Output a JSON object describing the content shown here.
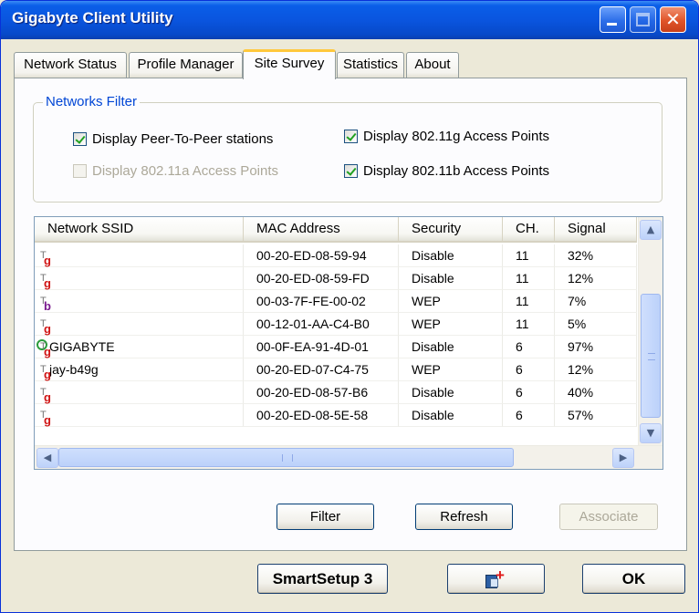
{
  "window": {
    "title": "Gigabyte Client Utility"
  },
  "tabs": [
    {
      "label": "Network Status"
    },
    {
      "label": "Profile Manager"
    },
    {
      "label": "Site Survey"
    },
    {
      "label": "Statistics"
    },
    {
      "label": "About"
    }
  ],
  "active_tab": "Site Survey",
  "filter": {
    "legend": "Networks Filter",
    "options": [
      {
        "label": "Display Peer-To-Peer stations",
        "checked": true,
        "enabled": true
      },
      {
        "label": "Display 802.11a Access Points",
        "checked": false,
        "enabled": false
      },
      {
        "label": "Display 802.11g Access Points",
        "checked": true,
        "enabled": true
      },
      {
        "label": "Display 802.11b Access Points",
        "checked": true,
        "enabled": true
      }
    ]
  },
  "table": {
    "columns": [
      "Network SSID",
      "MAC Address",
      "Security",
      "CH.",
      "Signal"
    ],
    "rows": [
      {
        "band": "g",
        "ssid": "",
        "mac": "00-20-ED-08-59-94",
        "security": "Disable",
        "ch": "11",
        "signal": "32%"
      },
      {
        "band": "g",
        "ssid": "",
        "mac": "00-20-ED-08-59-FD",
        "security": "Disable",
        "ch": "11",
        "signal": "12%"
      },
      {
        "band": "b",
        "ssid": "",
        "mac": "00-03-7F-FE-00-02",
        "security": "WEP",
        "ch": "11",
        "signal": "7%"
      },
      {
        "band": "g",
        "ssid": "",
        "mac": "00-12-01-AA-C4-B0",
        "security": "WEP",
        "ch": "11",
        "signal": "5%"
      },
      {
        "band": "g",
        "ssid": "GIGABYTE",
        "mac": "00-0F-EA-91-4D-01",
        "security": "Disable",
        "ch": "6",
        "signal": "97%",
        "connected": true
      },
      {
        "band": "g",
        "ssid": "jay-b49g",
        "mac": "00-20-ED-07-C4-75",
        "security": "WEP",
        "ch": "6",
        "signal": "12%"
      },
      {
        "band": "g",
        "ssid": "",
        "mac": "00-20-ED-08-57-B6",
        "security": "Disable",
        "ch": "6",
        "signal": "40%"
      },
      {
        "band": "g",
        "ssid": "",
        "mac": "00-20-ED-08-5E-58",
        "security": "Disable",
        "ch": "6",
        "signal": "57%"
      }
    ]
  },
  "buttons": {
    "filter": "Filter",
    "refresh": "Refresh",
    "associate": "Associate",
    "smartsetup": "SmartSetup 3",
    "ok": "OK"
  },
  "icons": {
    "minimize": "minimize-icon",
    "maximize": "maximize-icon",
    "close": "close-icon",
    "close_glyph": "✕",
    "scroll_up": "▲",
    "scroll_down": "▼",
    "scroll_left": "◀",
    "scroll_right": "▶"
  }
}
